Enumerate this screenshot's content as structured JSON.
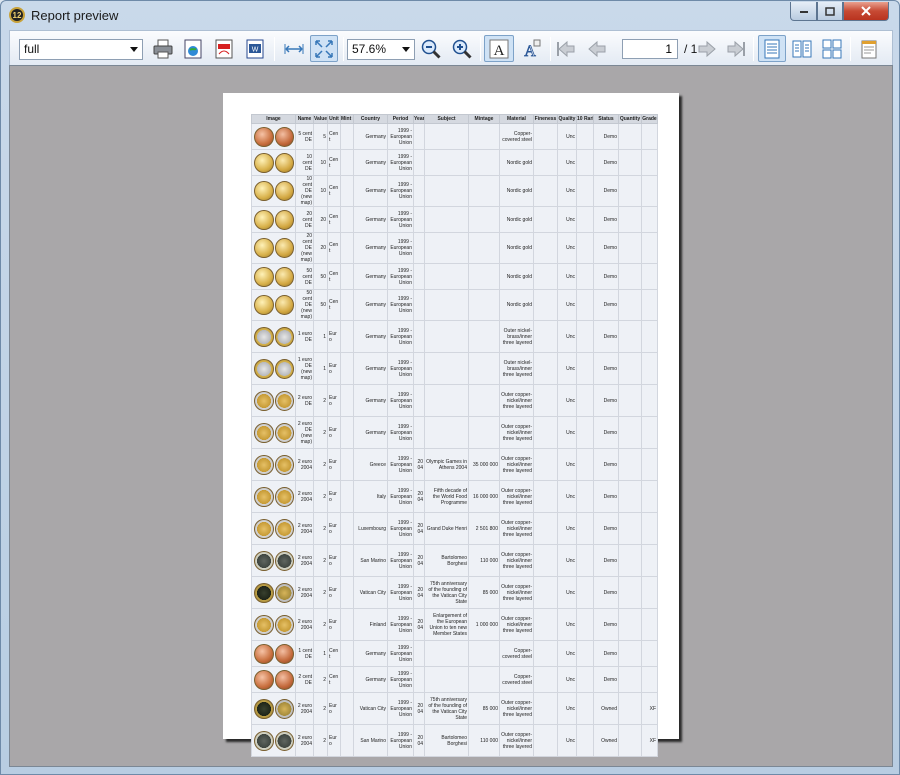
{
  "window": {
    "title": "Report preview",
    "app_icon": "12"
  },
  "toolbar": {
    "format_value": "full",
    "zoom_value": "57.6%",
    "page_current": "1",
    "page_total": "/ 1"
  },
  "report": {
    "headers": [
      "Image",
      "Name",
      "Value",
      "Unit",
      "Mint mark",
      "Country",
      "Period",
      "Year",
      "Subject",
      "Mintage",
      "Material",
      "Fineness",
      "Quality",
      "10 Rarity",
      "Status",
      "Quantity",
      "Grade"
    ],
    "rows": [
      {
        "name": "5 cent DE",
        "value": "5",
        "unit": "Cent",
        "country": "Germany",
        "period": "1999 - European Union",
        "year": "",
        "subject": "",
        "mintage": "",
        "material": "Copper-covered steel",
        "quality": "Unc",
        "status": "Demo",
        "grade": "",
        "coin": "copper"
      },
      {
        "name": "10 cent DE",
        "value": "10",
        "unit": "Cent",
        "country": "Germany",
        "period": "1999 - European Union",
        "year": "",
        "subject": "",
        "mintage": "",
        "material": "Nordic gold",
        "quality": "Unc",
        "status": "Demo",
        "grade": "",
        "coin": "gold"
      },
      {
        "name": "10 cent DE (new map)",
        "value": "10",
        "unit": "Cent",
        "country": "Germany",
        "period": "1999 - European Union",
        "year": "",
        "subject": "",
        "mintage": "",
        "material": "Nordic gold",
        "quality": "Unc",
        "status": "Demo",
        "grade": "",
        "coin": "gold"
      },
      {
        "name": "20 cent DE",
        "value": "20",
        "unit": "Cent",
        "country": "Germany",
        "period": "1999 - European Union",
        "year": "",
        "subject": "",
        "mintage": "",
        "material": "Nordic gold",
        "quality": "Unc",
        "status": "Demo",
        "grade": "",
        "coin": "gold"
      },
      {
        "name": "20 cent DE (new map)",
        "value": "20",
        "unit": "Cent",
        "country": "Germany",
        "period": "1999 - European Union",
        "year": "",
        "subject": "",
        "mintage": "",
        "material": "Nordic gold",
        "quality": "Unc",
        "status": "Demo",
        "grade": "",
        "coin": "gold"
      },
      {
        "name": "50 cent DE",
        "value": "50",
        "unit": "Cent",
        "country": "Germany",
        "period": "1999 - European Union",
        "year": "",
        "subject": "",
        "mintage": "",
        "material": "Nordic gold",
        "quality": "Unc",
        "status": "Demo",
        "grade": "",
        "coin": "gold"
      },
      {
        "name": "50 cent DE (new map)",
        "value": "50",
        "unit": "Cent",
        "country": "Germany",
        "period": "1999 - European Union",
        "year": "",
        "subject": "",
        "mintage": "",
        "material": "Nordic gold",
        "quality": "Unc",
        "status": "Demo",
        "grade": "",
        "coin": "gold"
      },
      {
        "name": "1 euro DE",
        "value": "1",
        "unit": "Euro",
        "country": "Germany",
        "period": "1999 - European Union",
        "year": "",
        "subject": "",
        "mintage": "",
        "material": "Outer nickel-brass/inner three layered",
        "quality": "Unc",
        "status": "Demo",
        "grade": "",
        "coin": "bimetal1"
      },
      {
        "name": "1 euro DE (new map)",
        "value": "1",
        "unit": "Euro",
        "country": "Germany",
        "period": "1999 - European Union",
        "year": "",
        "subject": "",
        "mintage": "",
        "material": "Outer nickel-brass/inner three layered",
        "quality": "Unc",
        "status": "Demo",
        "grade": "",
        "coin": "bimetal1"
      },
      {
        "name": "2 euro DE",
        "value": "2",
        "unit": "Euro",
        "country": "Germany",
        "period": "1999 - European Union",
        "year": "",
        "subject": "",
        "mintage": "",
        "material": "Outer copper-nickel/inner three layered",
        "quality": "Unc",
        "status": "Demo",
        "grade": "",
        "coin": "bimetal2"
      },
      {
        "name": "2 euro DE (new map)",
        "value": "2",
        "unit": "Euro",
        "country": "Germany",
        "period": "1999 - European Union",
        "year": "",
        "subject": "",
        "mintage": "",
        "material": "Outer copper-nickel/inner three layered",
        "quality": "Unc",
        "status": "Demo",
        "grade": "",
        "coin": "bimetal2"
      },
      {
        "name": "2 euro 2004",
        "value": "2",
        "unit": "Euro",
        "country": "Greece",
        "period": "1999 - European Union",
        "year": "2004",
        "subject": "Olympic Games in Athens 2004",
        "mintage": "35 000 000",
        "material": "Outer copper-nickel/inner three layered",
        "quality": "Unc",
        "status": "Demo",
        "grade": "",
        "coin": "bimetal2"
      },
      {
        "name": "2 euro 2004",
        "value": "2",
        "unit": "Euro",
        "country": "Italy",
        "period": "1999 - European Union",
        "year": "2004",
        "subject": "Fifth decade of the World Food Programme",
        "mintage": "16 000 000",
        "material": "Outer copper-nickel/inner three layered",
        "quality": "Unc",
        "status": "Demo",
        "grade": "",
        "coin": "bimetal2"
      },
      {
        "name": "2 euro 2004",
        "value": "2",
        "unit": "Euro",
        "country": "Luxembourg",
        "period": "1999 - European Union",
        "year": "2004",
        "subject": "Grand Duke Henri",
        "mintage": "2 501 800",
        "material": "Outer copper-nickel/inner three layered",
        "quality": "Unc",
        "status": "Demo",
        "grade": "",
        "coin": "bimetal2"
      },
      {
        "name": "2 euro 2004",
        "value": "2",
        "unit": "Euro",
        "country": "San Marino",
        "period": "1999 - European Union",
        "year": "2004",
        "subject": "Bartolomeo Borghesi",
        "mintage": "110 000",
        "material": "Outer copper-nickel/inner three layered",
        "quality": "Unc",
        "status": "Demo",
        "grade": "",
        "coin": "bimetal3"
      },
      {
        "name": "2 euro 2004",
        "value": "2",
        "unit": "Euro",
        "country": "Vatican City",
        "period": "1999 - European Union",
        "year": "2004",
        "subject": "75th anniversary of the founding of the Vatican City State",
        "mintage": "85 000",
        "material": "Outer copper-nickel/inner three layered",
        "quality": "Unc",
        "status": "Demo",
        "grade": "",
        "coin": "dark"
      },
      {
        "name": "2 euro 2004",
        "value": "2",
        "unit": "Euro",
        "country": "Finland",
        "period": "1999 - European Union",
        "year": "2004",
        "subject": "Enlargement of the European Union to ten new Member States",
        "mintage": "1 000 000",
        "material": "Outer copper-nickel/inner three layered",
        "quality": "Unc",
        "status": "Demo",
        "grade": "",
        "coin": "bimetal2"
      },
      {
        "name": "1 cent DE",
        "value": "1",
        "unit": "Cent",
        "country": "Germany",
        "period": "1999 - European Union",
        "year": "",
        "subject": "",
        "mintage": "",
        "material": "Copper-covered steel",
        "quality": "Unc",
        "status": "Demo",
        "grade": "",
        "coin": "copper"
      },
      {
        "name": "2 cent DE",
        "value": "2",
        "unit": "Cent",
        "country": "Germany",
        "period": "1999 - European Union",
        "year": "",
        "subject": "",
        "mintage": "",
        "material": "Copper-covered steel",
        "quality": "Unc",
        "status": "Demo",
        "grade": "",
        "coin": "copper"
      },
      {
        "name": "2 euro 2004",
        "value": "2",
        "unit": "Euro",
        "country": "Vatican City",
        "period": "1999 - European Union",
        "year": "2004",
        "subject": "75th anniversary of the founding of the Vatican City State",
        "mintage": "85 000",
        "material": "Outer copper-nickel/inner three layered",
        "quality": "Unc",
        "status": "Owned",
        "grade": "XF",
        "coin": "dark"
      },
      {
        "name": "2 euro 2004",
        "value": "2",
        "unit": "Euro",
        "country": "San Marino",
        "period": "1999 - European Union",
        "year": "2004",
        "subject": "Bartolomeo Borghesi",
        "mintage": "110 000",
        "material": "Outer copper-nickel/inner three layered",
        "quality": "Unc",
        "status": "Owned",
        "grade": "XF",
        "coin": "bimetal3"
      }
    ]
  },
  "icons": [
    "print-icon",
    "export-image-icon",
    "export-pdf-icon",
    "export-word-icon",
    "fit-width-icon",
    "fit-page-icon",
    "zoom-out-icon",
    "zoom-in-icon",
    "font-a-icon",
    "font-a-outline-icon",
    "first-page-icon",
    "prev-page-icon",
    "next-page-icon",
    "last-page-icon",
    "single-page-icon",
    "two-page-icon",
    "multi-page-icon",
    "page-setup-icon"
  ]
}
